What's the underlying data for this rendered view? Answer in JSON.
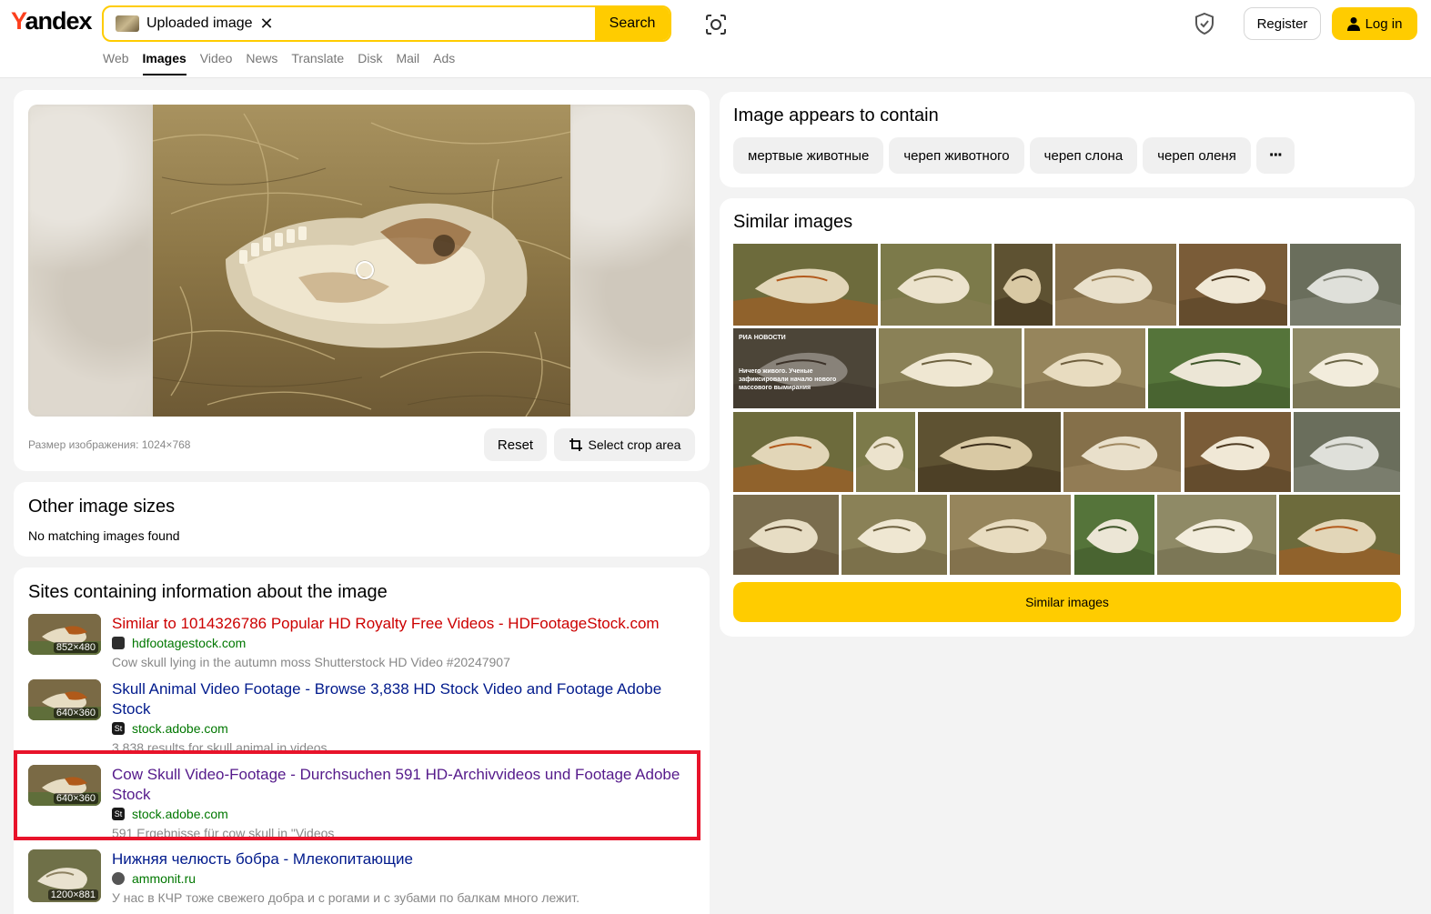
{
  "header": {
    "logo_first": "Y",
    "logo_rest": "andex",
    "search_chip_label": "Uploaded image",
    "search_button": "Search",
    "register": "Register",
    "login": "Log in",
    "nav": [
      "Web",
      "Images",
      "Video",
      "News",
      "Translate",
      "Disk",
      "Mail",
      "Ads"
    ],
    "nav_active": "Images"
  },
  "main_image": {
    "size_label": "Размер изображения: 1024×768",
    "reset": "Reset",
    "select_crop": "Select crop area"
  },
  "other_sizes": {
    "title": "Other image sizes",
    "message": "No matching images found"
  },
  "sites": {
    "title": "Sites containing information about the image",
    "items": [
      {
        "title": "Similar to 1014326786 Popular HD Royalty Free Videos - HDFootageStock.com",
        "host": "hdfootagestock.com",
        "desc": "Cow skull lying in the autumn moss Shutterstock HD Video #20247907",
        "res": "852×480"
      },
      {
        "title": "Skull Animal Video Footage - Browse 3,838 HD Stock Video and Footage Adobe Stock",
        "host": "stock.adobe.com",
        "desc": "3,838 results for skull animal in videos",
        "res": "640×360"
      },
      {
        "title": "Cow Skull Video-Footage - Durchsuchen 591 HD-Archivvideos und Footage Adobe Stock",
        "host": "stock.adobe.com",
        "desc": "591 Ergebnisse für cow skull in \"Videos",
        "res": "640×360"
      },
      {
        "title": "Нижняя челюсть бобра - Млекопитающие",
        "host": "ammonit.ru",
        "desc": "У нас в КЧР тоже свежего добра и с рогами и с зубами по балкам много лежит.",
        "res": "1200×881"
      }
    ]
  },
  "contains": {
    "title": "Image appears to contain",
    "tags": [
      "мертвые животные",
      "череп животного",
      "череп слона",
      "череп оленя"
    ],
    "more": "···"
  },
  "similar": {
    "title": "Similar images",
    "button": "Similar images",
    "thumb_overlay": [
      "РИА НОВОСТИ",
      "Ничего живого. Ученые зафиксировали начало нового массового вымирания"
    ]
  },
  "colors": {
    "accent": "#ffcc00",
    "logo_red": "#fc3f1d",
    "link": "#001a8c",
    "link_red": "#cc0000",
    "visited": "#551a8b",
    "host_green": "#007700",
    "highlight": "#e8132a"
  },
  "icons": [
    "image-thumb-icon",
    "close-icon",
    "lens-icon",
    "shield-icon",
    "user-icon",
    "crop-icon",
    "more-icon"
  ]
}
